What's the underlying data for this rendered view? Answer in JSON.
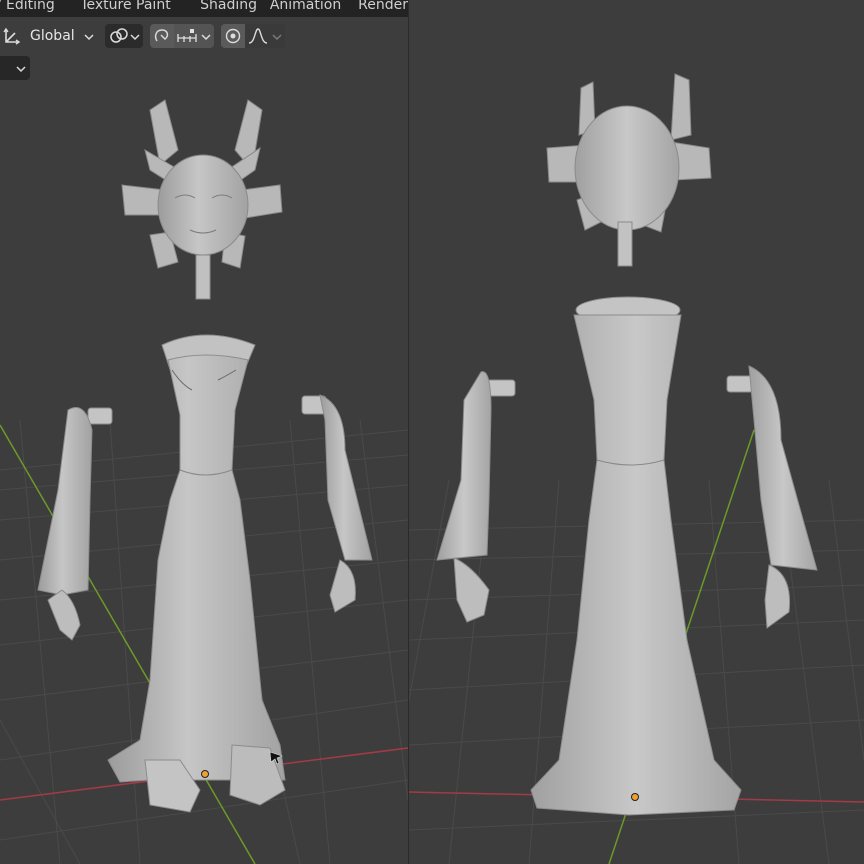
{
  "workspace_tabs": [
    "V Editing",
    "Texture Paint",
    "Shading",
    "Animation",
    "Render"
  ],
  "header": {
    "orientation_value": "Global",
    "orientation_icon": "transform-orientation-icon",
    "pivot_icon": "pivot-point-icon",
    "snap_icon": "snap-magnet-icon",
    "snap_target_icon": "snap-increment-icon",
    "proportional_icon": "proportional-edit-icon",
    "falloff_icon": "falloff-curve-icon"
  },
  "colors": {
    "viewport_bg": "#3d3d3d",
    "grid_line": "#4a4a4a",
    "x_axis": "#a23a48",
    "y_axis": "#6c9a28",
    "origin_point": "#f0a030",
    "model": "#b4b4b4"
  }
}
